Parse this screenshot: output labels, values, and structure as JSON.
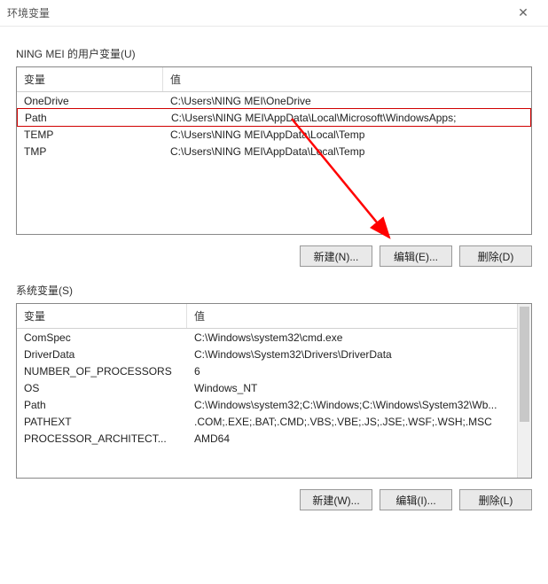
{
  "title": "环境变量",
  "user_section": {
    "label": "NING MEI 的用户变量(U)",
    "columns": {
      "name": "变量",
      "value": "值"
    },
    "rows": [
      {
        "name": "OneDrive",
        "value": "C:\\Users\\NING MEI\\OneDrive"
      },
      {
        "name": "Path",
        "value": "C:\\Users\\NING MEI\\AppData\\Local\\Microsoft\\WindowsApps;",
        "selected": true
      },
      {
        "name": "TEMP",
        "value": "C:\\Users\\NING MEI\\AppData\\Local\\Temp"
      },
      {
        "name": "TMP",
        "value": "C:\\Users\\NING MEI\\AppData\\Local\\Temp"
      }
    ],
    "buttons": {
      "new": "新建(N)...",
      "edit": "编辑(E)...",
      "del": "删除(D)"
    }
  },
  "system_section": {
    "label": "系统变量(S)",
    "columns": {
      "name": "变量",
      "value": "值"
    },
    "rows": [
      {
        "name": "ComSpec",
        "value": "C:\\Windows\\system32\\cmd.exe"
      },
      {
        "name": "DriverData",
        "value": "C:\\Windows\\System32\\Drivers\\DriverData"
      },
      {
        "name": "NUMBER_OF_PROCESSORS",
        "value": "6"
      },
      {
        "name": "OS",
        "value": "Windows_NT"
      },
      {
        "name": "Path",
        "value": "C:\\Windows\\system32;C:\\Windows;C:\\Windows\\System32\\Wb..."
      },
      {
        "name": "PATHEXT",
        "value": ".COM;.EXE;.BAT;.CMD;.VBS;.VBE;.JS;.JSE;.WSF;.WSH;.MSC"
      },
      {
        "name": "PROCESSOR_ARCHITECT...",
        "value": "AMD64"
      }
    ],
    "buttons": {
      "new": "新建(W)...",
      "edit": "编辑(I)...",
      "del": "删除(L)"
    }
  }
}
